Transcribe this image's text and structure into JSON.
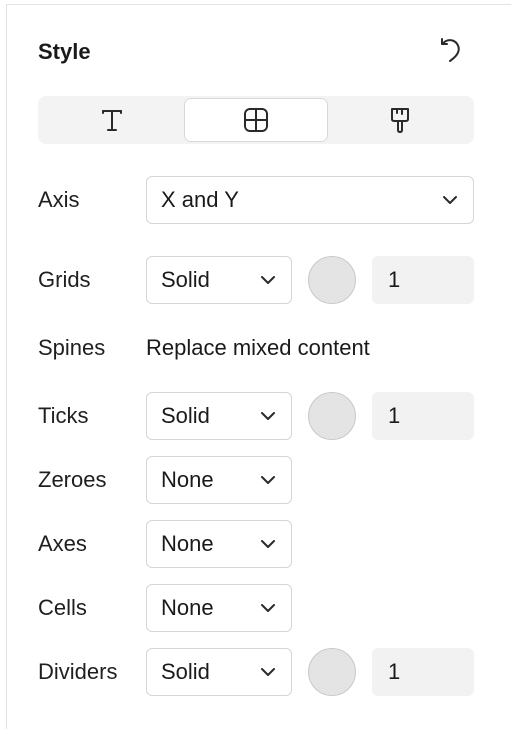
{
  "panel": {
    "title": "Style",
    "undo_icon": "undo-icon"
  },
  "tabs": [
    {
      "icon": "text-icon",
      "selected": false
    },
    {
      "icon": "grid-icon",
      "selected": true
    },
    {
      "icon": "paintbrush-icon",
      "selected": false
    }
  ],
  "rows": {
    "axis": {
      "label": "Axis",
      "value": "X and Y"
    },
    "grids": {
      "label": "Grids",
      "value": "Solid",
      "width": "1",
      "color": "#e4e4e4"
    },
    "spines": {
      "label": "Spines",
      "value": "Replace mixed content"
    },
    "ticks": {
      "label": "Ticks",
      "value": "Solid",
      "width": "1",
      "color": "#e4e4e4"
    },
    "zeroes": {
      "label": "Zeroes",
      "value": "None"
    },
    "axes": {
      "label": "Axes",
      "value": "None"
    },
    "cells": {
      "label": "Cells",
      "value": "None"
    },
    "dividers": {
      "label": "Dividers",
      "value": "Solid",
      "width": "1",
      "color": "#e4e4e4"
    }
  }
}
